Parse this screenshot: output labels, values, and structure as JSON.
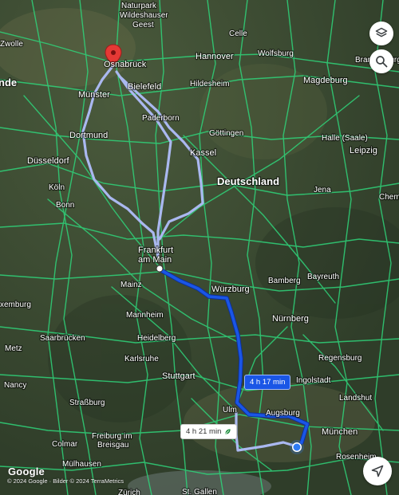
{
  "map": {
    "country_label": "Deutschland",
    "cities": {
      "naturpark": "Naturpark",
      "wildeshauser": "Wildeshauser",
      "geest": "Geest",
      "zwolle": "Zwolle",
      "celle": "Celle",
      "osnabruck": "Osnabrück",
      "hannover": "Hannover",
      "wolfsburg": "Wolfsburg",
      "bielefeld": "Bielefeld",
      "hildesheim": "Hildesheim",
      "magdeburg": "Magdeburg",
      "brandenburg": "Brandenburg an der Havel",
      "munster": "Münster",
      "paderborn": "Paderborn",
      "gottingen": "Göttingen",
      "dortmund": "Dortmund",
      "kassel": "Kassel",
      "halle": "Halle (Saale)",
      "leipzig": "Leipzig",
      "dusseldorf": "Düsseldorf",
      "koln": "Köln",
      "bonn": "Bonn",
      "jena": "Jena",
      "chemnitz": "Chem",
      "frankfurt_1": "Frankfurt",
      "frankfurt_2": "am Main",
      "wurzburg": "Würzburg",
      "bamberg": "Bamberg",
      "bayreuth": "Bayreuth",
      "mainz": "Mainz",
      "luxemburg": "xemburg",
      "mannheim": "Mannheim",
      "nurnberg": "Nürnberg",
      "saarbrucken": "Saarbrücken",
      "heidelberg": "Heidelberg",
      "metz": "Metz",
      "karlsruhe": "Karlsruhe",
      "regensburg": "Regensburg",
      "stuttgart": "Stuttgart",
      "ingolstadt": "Ingolstadt",
      "nancy": "Nancy",
      "strasbourg": "Straßburg",
      "landshut": "Landshut",
      "ulm": "Ulm",
      "augsburg": "Augsburg",
      "munchen": "München",
      "colmar": "Colmar",
      "freiburg_1": "Freiburg im",
      "freiburg_2": "Breisgau",
      "rosenheim": "Rosenheim",
      "mulhausen": "Mülhausen",
      "zurich": "Zürich",
      "stgallen": "St. Gallen",
      "nde": "nde"
    },
    "routes": {
      "primary_duration": "4 h 17 min",
      "alternative_duration": "4 h 21 min"
    }
  },
  "controls": {
    "layers_icon": "layers-icon",
    "search_icon": "search-icon",
    "navigate_icon": "navigation-arrow-icon"
  },
  "footer": {
    "logo": "Google",
    "attribution": "© 2024 Google · Bilder © 2024 TerraMetrics"
  },
  "colors": {
    "primary_route": "#1a56e6",
    "alternative_route": "#aab8f0",
    "highway": "#2fd47a",
    "terrain": "#3b4a32",
    "destination_pin": "#e53935",
    "origin_dot": "#2f7cf6"
  }
}
